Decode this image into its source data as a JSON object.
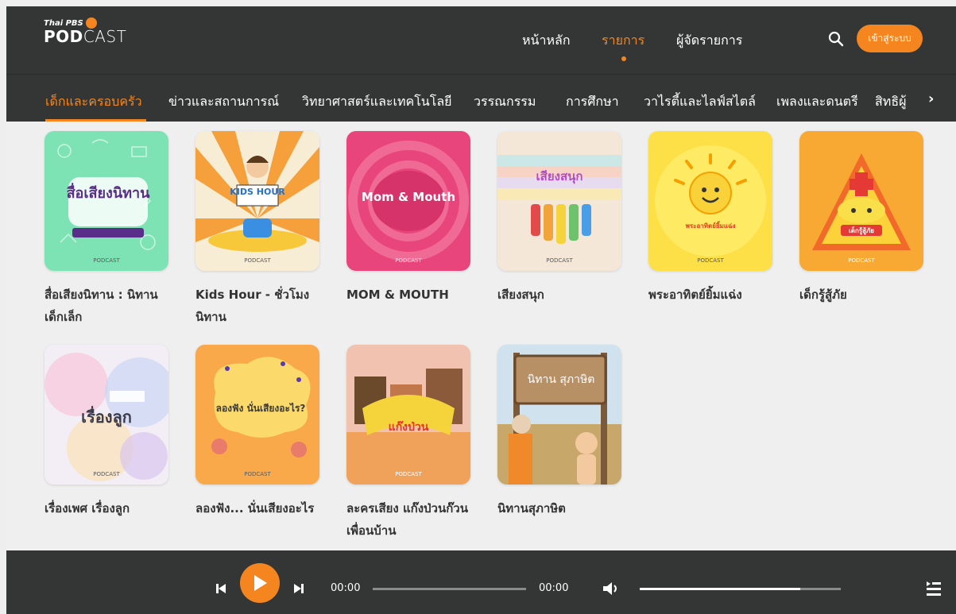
{
  "header": {
    "logo_small": "Thai PBS",
    "logo_pod": "POD",
    "logo_cast": "CAST",
    "nav": [
      {
        "label": "หน้าหลัก",
        "active": false
      },
      {
        "label": "รายการ",
        "active": true
      },
      {
        "label": "ผู้จัดรายการ",
        "active": false
      }
    ],
    "login_label": "เข้าสู่ระบบ",
    "search_icon": "search-icon"
  },
  "categories": [
    {
      "label": "เด็กและครอบครัว",
      "active": true
    },
    {
      "label": "ข่าวและสถานการณ์",
      "active": false
    },
    {
      "label": "วิทยาศาสตร์และเทคโนโลยี",
      "active": false
    },
    {
      "label": "วรรณกรรม",
      "active": false
    },
    {
      "label": "การศึกษา",
      "active": false
    },
    {
      "label": "วาไรตี้และไลฟ์สไตล์",
      "active": false
    },
    {
      "label": "เพลงและดนตรี",
      "active": false
    },
    {
      "label": "สิทธิผู้",
      "active": false
    }
  ],
  "podcasts": [
    {
      "title": "สื่อเสียงนิทาน : นิทานเด็กเล็ก",
      "cover_text": "สื่อเสียงนิทาน"
    },
    {
      "title": "Kids Hour - ชั่วโมงนิทาน",
      "cover_text": "KIDS HOUR"
    },
    {
      "title": "MOM & MOUTH",
      "cover_text": "Mom & Mouth"
    },
    {
      "title": "เสียงสนุก",
      "cover_text": "เสียงสนุก"
    },
    {
      "title": "พระอาทิตย์ยิ้มแฉ่ง",
      "cover_text": "พระอาทิตย์ยิ้มแฉ่ง"
    },
    {
      "title": "เด็กรู้สู้ภัย",
      "cover_text": "เด็กรู้สู้ภัย"
    },
    {
      "title": "เรื่องเพศ เรื่องลูก",
      "cover_text": "เรื่องลูก"
    },
    {
      "title": "ลองฟัง... นั่นเสียงอะไร",
      "cover_text": "ลองฟัง นั่นเสียงอะไร?"
    },
    {
      "title": "ละครเสียง แก๊งป่วนก๊วนเพื่อนบ้าน",
      "cover_text": "แก๊งป่วน"
    },
    {
      "title": "นิทานสุภาษิต",
      "cover_text": "นิทาน สุภาษิต"
    }
  ],
  "player": {
    "current_time": "00:00",
    "duration": "00:00",
    "progress": 0,
    "volume": 0.8
  },
  "colors": {
    "accent": "#f5861f",
    "bar": "#343636",
    "background": "#efefef"
  }
}
